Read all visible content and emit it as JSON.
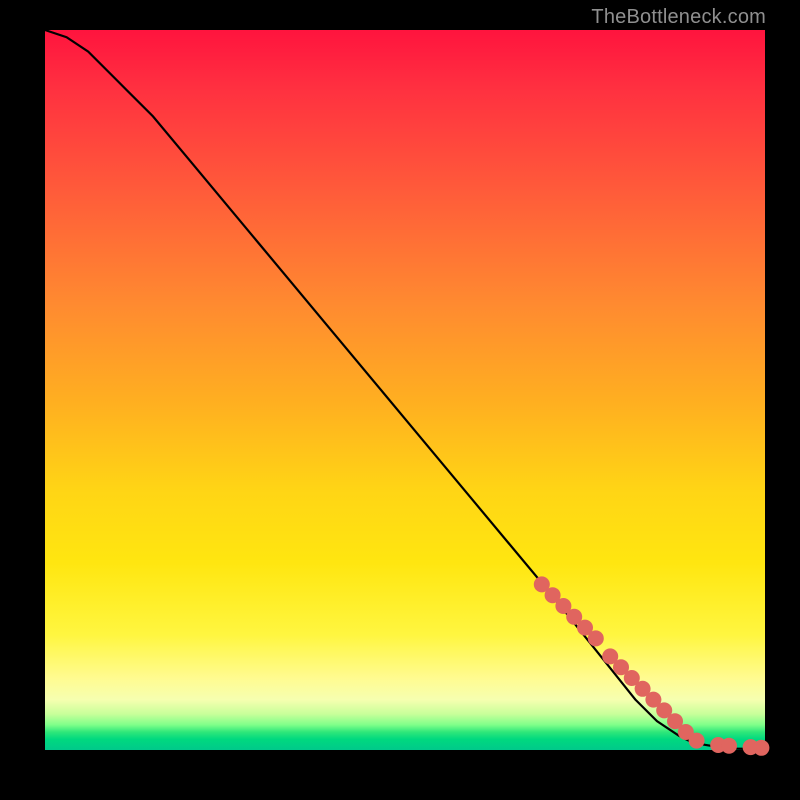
{
  "watermark": "TheBottleneck.com",
  "chart_data": {
    "type": "line",
    "title": "",
    "xlabel": "",
    "ylabel": "",
    "xlim": [
      0,
      100
    ],
    "ylim": [
      0,
      100
    ],
    "curve": {
      "name": "bottleneck-curve",
      "x": [
        0,
        3,
        6,
        10,
        15,
        20,
        30,
        40,
        50,
        60,
        70,
        78,
        82,
        85,
        88,
        90,
        93,
        96,
        100
      ],
      "y": [
        100,
        99,
        97,
        93,
        88,
        82,
        70,
        58,
        46,
        34,
        22,
        12,
        7,
        4,
        2,
        1,
        0.5,
        0.2,
        0.1
      ]
    },
    "dots": {
      "name": "highlighted-segment",
      "color": "#e0655f",
      "radius_px": 8,
      "x": [
        69,
        70.5,
        72,
        73.5,
        75,
        76.5,
        78.5,
        80,
        81.5,
        83,
        84.5,
        86,
        87.5,
        89,
        90.5,
        93.5,
        95,
        98,
        99.5
      ],
      "y": [
        23,
        21.5,
        20,
        18.5,
        17,
        15.5,
        13,
        11.5,
        10,
        8.5,
        7,
        5.5,
        4,
        2.5,
        1.3,
        0.7,
        0.6,
        0.4,
        0.3
      ]
    }
  },
  "colors": {
    "frame_bg": "#000000",
    "curve": "#000000",
    "dot": "#e0655f",
    "watermark": "#8f8f8f"
  }
}
